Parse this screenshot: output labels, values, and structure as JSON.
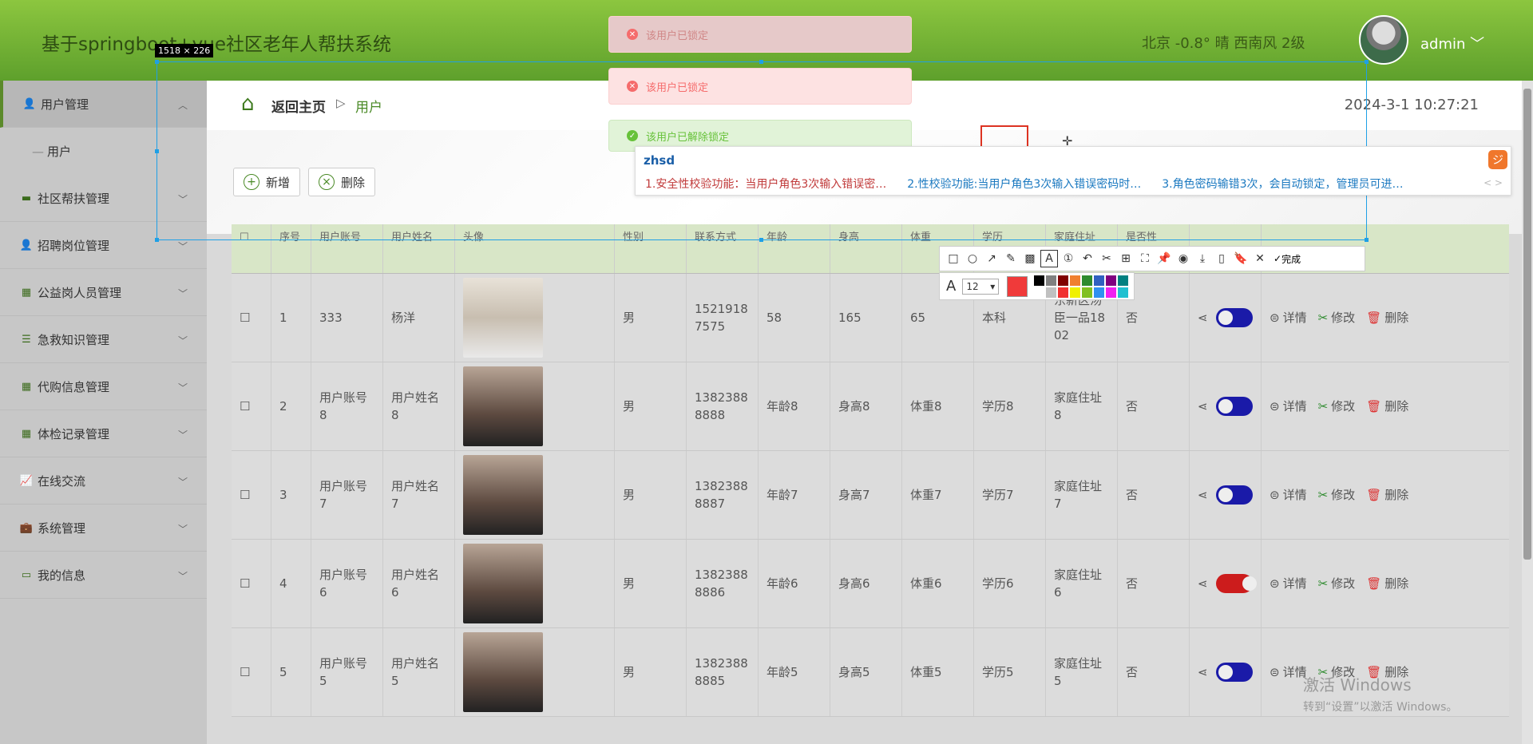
{
  "header": {
    "title": "基于springboot+vue社区老年人帮扶系统",
    "weather": "北京 -0.8° 晴 西南风 2级",
    "username": "admin"
  },
  "sidebar": {
    "items": [
      {
        "label": "用户管理",
        "icon": "user-icon",
        "chev": "︿"
      },
      {
        "label": "社区帮扶管理",
        "icon": "monitor-icon",
        "chev": "﹀"
      },
      {
        "label": "招聘岗位管理",
        "icon": "user-icon",
        "chev": "﹀"
      },
      {
        "label": "公益岗人员管理",
        "icon": "grid-icon",
        "chev": "﹀"
      },
      {
        "label": "急救知识管理",
        "icon": "list-icon",
        "chev": "﹀"
      },
      {
        "label": "代购信息管理",
        "icon": "grid9-icon",
        "chev": "﹀"
      },
      {
        "label": "体检记录管理",
        "icon": "grid-icon",
        "chev": "﹀"
      },
      {
        "label": "在线交流",
        "icon": "chart-icon",
        "chev": "﹀"
      },
      {
        "label": "系统管理",
        "icon": "briefcase-icon",
        "chev": "﹀"
      },
      {
        "label": "我的信息",
        "icon": "card-icon",
        "chev": "﹀"
      }
    ],
    "sub_item": "用户"
  },
  "breadcrumb": {
    "home": "返回主页",
    "sep": "▷",
    "current": "用户"
  },
  "datetime": "2024-3-1 10:27:21",
  "toolbar": {
    "add_label": "新增",
    "delete_label": "删除"
  },
  "table": {
    "headers": [
      "序号",
      "用户账号",
      "用户姓名",
      "头像",
      "性别",
      "联系方式",
      "年龄",
      "身高",
      "体重",
      "学历",
      "家庭住址",
      "是否性"
    ],
    "rows": [
      {
        "no": "1",
        "account": "333",
        "name": "杨洋",
        "gender": "男",
        "phone": "15219187575",
        "age": "58",
        "height": "165",
        "weight": "65",
        "edu": "本科",
        "address": "东新区汤臣一品1802",
        "flag": "否",
        "status": "on-blue"
      },
      {
        "no": "2",
        "account": "用户账号8",
        "name": "用户姓名8",
        "gender": "男",
        "phone": "13823888888",
        "age": "年龄8",
        "height": "身高8",
        "weight": "体重8",
        "edu": "学历8",
        "address": "家庭住址8",
        "flag": "否",
        "status": "on-blue"
      },
      {
        "no": "3",
        "account": "用户账号7",
        "name": "用户姓名7",
        "gender": "男",
        "phone": "13823888887",
        "age": "年龄7",
        "height": "身高7",
        "weight": "体重7",
        "edu": "学历7",
        "address": "家庭住址7",
        "flag": "否",
        "status": "on-blue"
      },
      {
        "no": "4",
        "account": "用户账号6",
        "name": "用户姓名6",
        "gender": "男",
        "phone": "13823888886",
        "age": "年龄6",
        "height": "身高6",
        "weight": "体重6",
        "edu": "学历6",
        "address": "家庭住址6",
        "flag": "否",
        "status": "red"
      },
      {
        "no": "5",
        "account": "用户账号5",
        "name": "用户姓名5",
        "gender": "男",
        "phone": "13823888885",
        "age": "年龄5",
        "height": "身高5",
        "weight": "体重5",
        "edu": "学历5",
        "address": "家庭住址5",
        "flag": "否",
        "status": "on-blue"
      }
    ],
    "actions": {
      "detail": "详情",
      "edit": "修改",
      "delete": "删除"
    }
  },
  "messages": [
    {
      "type": "error",
      "text": "该用户已锁定"
    },
    {
      "type": "error",
      "text": "该用户已锁定"
    },
    {
      "type": "success",
      "text": "该用户已解除锁定"
    }
  ],
  "screenshot_tool": {
    "size_label": "1518 × 226",
    "ime_input": "zhsd",
    "candidates": [
      "1.安全性校验功能：当用户角色3次输入错误密…",
      "2.性校验功能:当用户角色3次输入错误密码时…",
      "3.角色密码输错3次，会自动锁定，管理员可进…"
    ],
    "ime_arrows": "< >",
    "done_label": "完成",
    "font_size": "12",
    "current_color": "#f03a3a",
    "palette": [
      "#000000",
      "#808080",
      "#800000",
      "#f08030",
      "#2e8b2e",
      "#3060c0",
      "#800080",
      "#008080",
      "#ffffff",
      "#c0c0c0",
      "#f03030",
      "#f0f000",
      "#80c020",
      "#3090f0",
      "#f020f0",
      "#20c0d0"
    ]
  },
  "watermark": {
    "line1": "激活 Windows",
    "line2": "转到“设置”以激活 Windows。"
  }
}
